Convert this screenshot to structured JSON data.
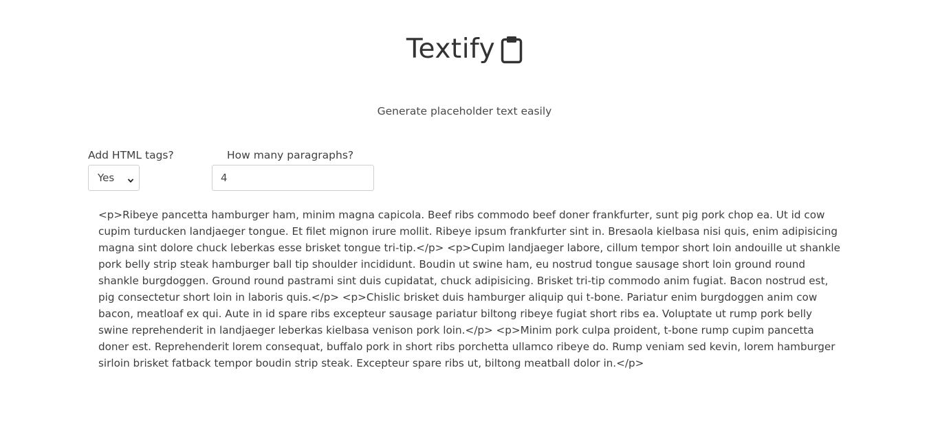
{
  "header": {
    "title": "Textify",
    "icon": "clipboard-icon"
  },
  "subtitle": "Generate placeholder text easily",
  "controls": {
    "tags_label": "Add HTML tags?",
    "tags_selected": "Yes",
    "count_label": "How many paragraphs?",
    "count_value": "4"
  },
  "output": {
    "text": "<p>Ribeye pancetta hamburger ham, minim magna capicola. Beef ribs commodo beef doner frankfurter, sunt pig pork chop ea. Ut id cow cupim turducken landjaeger tongue. Et filet mignon irure mollit. Ribeye ipsum frankfurter sint in. Bresaola kielbasa nisi quis, enim adipisicing magna sint dolore chuck leberkas esse brisket tongue tri-tip.</p> <p>Cupim landjaeger labore, cillum tempor short loin andouille ut shankle pork belly strip steak hamburger ball tip shoulder incididunt. Boudin ut swine ham, eu nostrud tongue sausage short loin ground round shankle burgdoggen. Ground round pastrami sint duis cupidatat, chuck adipisicing. Brisket tri-tip commodo anim fugiat. Bacon nostrud est, pig consectetur short loin in laboris quis.</p> <p>Chislic brisket duis hamburger aliquip qui t-bone. Pariatur enim burgdoggen anim cow bacon, meatloaf ex qui. Aute in id spare ribs excepteur sausage pariatur biltong ribeye fugiat short ribs ea. Voluptate ut rump pork belly swine reprehenderit in landjaeger leberkas kielbasa venison pork loin.</p> <p>Minim pork culpa proident, t-bone rump cupim pancetta doner est. Reprehenderit lorem consequat, buffalo pork in short ribs porchetta ullamco ribeye do. Rump veniam sed kevin, lorem hamburger sirloin brisket fatback tempor boudin strip steak. Excepteur spare ribs ut, biltong meatball dolor in.</p>"
  }
}
